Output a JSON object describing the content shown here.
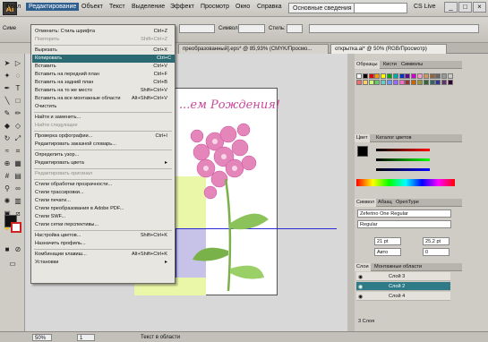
{
  "app": {
    "logo": "Ai"
  },
  "menubar": {
    "items": [
      "Файл",
      "Редактирование",
      "Объект",
      "Текст",
      "Выделение",
      "Эффект",
      "Просмотр",
      "Окно",
      "Справка"
    ],
    "workspace": "Основные сведения",
    "cs_live": "CS Live",
    "window_buttons": [
      "_",
      "□",
      "×"
    ]
  },
  "controlbar": {
    "left_label": "Симе",
    "symbol_label": "Символ",
    "style_label": "Стиль:"
  },
  "tabs": [
    {
      "label": "преобразованный].eps* @ 85,93% (CMYK/Просмо..."
    },
    {
      "label": "открытка.ai* @ 50% (RGB/Просмотр)"
    }
  ],
  "edit_menu": [
    {
      "label": "Отменить: Стиль шрифта",
      "shortcut": "Ctrl+Z",
      "disabled": false
    },
    {
      "label": "Повторить",
      "shortcut": "Shift+Ctrl+Z",
      "disabled": true
    },
    {
      "sep": true
    },
    {
      "label": "Вырезать",
      "shortcut": "Ctrl+X",
      "disabled": false
    },
    {
      "label": "Копировать",
      "shortcut": "Ctrl+C",
      "disabled": false,
      "highlight": true
    },
    {
      "label": "Вставить",
      "shortcut": "Ctrl+V",
      "disabled": false
    },
    {
      "label": "Вставить на передний план",
      "shortcut": "Ctrl+F",
      "disabled": false
    },
    {
      "label": "Вставить на задний план",
      "shortcut": "Ctrl+B",
      "disabled": false
    },
    {
      "label": "Вставить на то же место",
      "shortcut": "Shift+Ctrl+V",
      "disabled": false
    },
    {
      "label": "Вставить на все монтажные области",
      "shortcut": "Alt+Shift+Ctrl+V",
      "disabled": false
    },
    {
      "label": "Очистить",
      "shortcut": "",
      "disabled": false
    },
    {
      "sep": true
    },
    {
      "label": "Найти и заменить...",
      "shortcut": "",
      "disabled": false
    },
    {
      "label": "Найти следующее",
      "shortcut": "",
      "disabled": true
    },
    {
      "sep": true
    },
    {
      "label": "Проверка орфографии...",
      "shortcut": "Ctrl+I",
      "disabled": false
    },
    {
      "label": "Редактировать заказной словарь...",
      "shortcut": "",
      "disabled": false
    },
    {
      "sep": true
    },
    {
      "label": "Определить узор...",
      "shortcut": "",
      "disabled": false
    },
    {
      "label": "Редактировать цвета",
      "shortcut": "",
      "disabled": false,
      "submenu": true
    },
    {
      "sep": true
    },
    {
      "label": "Редактировать оригинал",
      "shortcut": "",
      "disabled": true
    },
    {
      "sep": true
    },
    {
      "label": "Стили обработки прозрачности...",
      "shortcut": "",
      "disabled": false
    },
    {
      "label": "Стили трассировки...",
      "shortcut": "",
      "disabled": false
    },
    {
      "label": "Стили печати...",
      "shortcut": "",
      "disabled": false
    },
    {
      "label": "Стили преобразования в Adobe PDF...",
      "shortcut": "",
      "disabled": false
    },
    {
      "label": "Стили SWF...",
      "shortcut": "",
      "disabled": false
    },
    {
      "label": "Стили сетки перспективы...",
      "shortcut": "",
      "disabled": false
    },
    {
      "sep": true
    },
    {
      "label": "Настройка цветов...",
      "shortcut": "Shift+Ctrl+K",
      "disabled": false
    },
    {
      "label": "Назначить профиль...",
      "shortcut": "",
      "disabled": false
    },
    {
      "sep": true
    },
    {
      "label": "Комбинации клавиш...",
      "shortcut": "Alt+Shift+Ctrl+K",
      "disabled": false
    },
    {
      "label": "Установки",
      "shortcut": "",
      "disabled": false,
      "submenu": true
    }
  ],
  "canvas": {
    "heading_text": "...ем Рождения!"
  },
  "panels": {
    "swatches_tabs": [
      "Образцы",
      "Кисти",
      "Символы"
    ],
    "color_tabs": [
      "Цвет",
      "Каталог цветов"
    ],
    "character_tabs": [
      "Символ",
      "Абзац",
      "OpenType"
    ],
    "font_name": "Zeferino One Regular",
    "font_style": "Regular",
    "font_size": "21 pt",
    "leading": "25,2 pt",
    "kerning": "Авто",
    "tracking": "0",
    "layers_tabs": [
      "Слои",
      "Монтажные области"
    ],
    "layers": [
      {
        "name": "Слой 3",
        "selected": false
      },
      {
        "name": "Слой 2",
        "selected": true
      },
      {
        "name": "Слой 4",
        "selected": false
      }
    ],
    "layers_footer": "3 Слоя"
  },
  "status": {
    "zoom": "50%",
    "page": "1",
    "info": "Текст в области"
  },
  "colors": {
    "menu_highlight": "#2c6a73",
    "layer_selected": "#2e7a87",
    "heading": "#c8489a"
  }
}
